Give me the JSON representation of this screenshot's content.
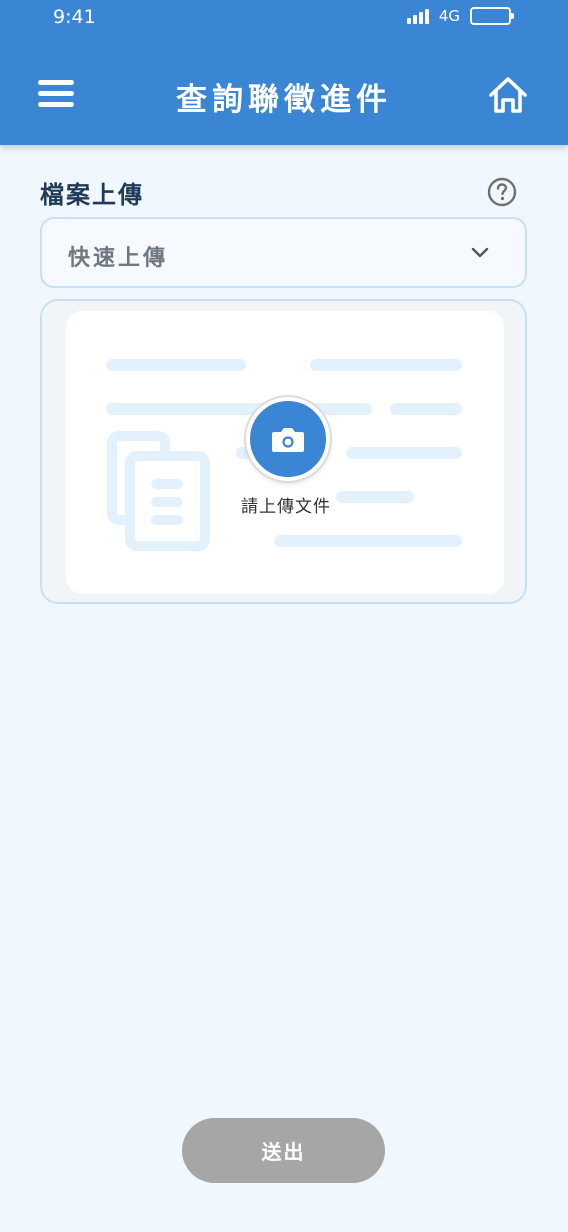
{
  "status_bar": {
    "time": "9:41",
    "network": "4G"
  },
  "header": {
    "title": "查詢聯徵進件"
  },
  "section": {
    "title": "檔案上傳"
  },
  "dropdown": {
    "selected": "快速上傳"
  },
  "upload": {
    "label": "請上傳文件"
  },
  "footer": {
    "submit_label": "送出"
  },
  "colors": {
    "header_bg": "#3a86d4",
    "page_bg": "#f0f7fe",
    "border": "#c4e1f8",
    "submit_disabled": "#a6a6a6"
  },
  "icons": [
    "signal-icon",
    "battery-icon",
    "menu-icon",
    "home-icon",
    "help-icon",
    "chevron-down-icon",
    "document-icon",
    "camera-icon"
  ]
}
